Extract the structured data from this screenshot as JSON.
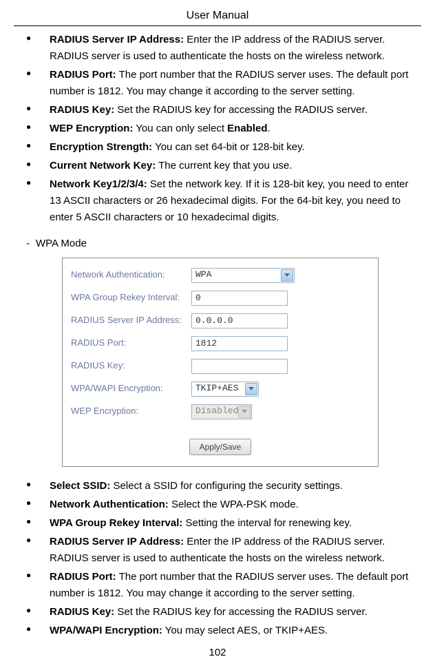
{
  "header": "User Manual",
  "top_bullets": [
    {
      "label": "RADIUS Server IP Address:",
      "text": " Enter the IP address of the RADIUS server. RADIUS server is used to authenticate the hosts on the wireless network."
    },
    {
      "label": "RADIUS Port:",
      "text": " The port number that the RADIUS server uses. The default port number is 1812. You may change it according to the server setting."
    },
    {
      "label": "RADIUS Key:",
      "text": " Set the RADIUS key for accessing the RADIUS server."
    },
    {
      "label": "WEP Encryption:",
      "text": " You can only select ",
      "bold_after": "Enabled",
      "suffix": "."
    },
    {
      "label": "Encryption Strength:",
      "text": " You can set 64-bit or 128-bit key."
    },
    {
      "label": "Current Network Key:",
      "text": " The current key that you use."
    },
    {
      "label": "Network Key1/2/3/4:",
      "text": " Set the network key. If it is 128-bit key, you need to enter 13 ASCII characters or 26 hexadecimal digits. For the 64-bit key, you need to enter 5 ASCII characters or 10 hexadecimal digits."
    }
  ],
  "section_title": "WPA Mode",
  "form": {
    "rows": [
      {
        "label": "Network Authentication:",
        "type": "select_wide",
        "value": "WPA"
      },
      {
        "label": "WPA Group Rekey Interval:",
        "type": "input",
        "value": "0"
      },
      {
        "label": "RADIUS Server IP Address:",
        "type": "input",
        "value": "0.0.0.0"
      },
      {
        "label": "RADIUS Port:",
        "type": "input",
        "value": "1812"
      },
      {
        "label": "RADIUS Key:",
        "type": "input",
        "value": ""
      },
      {
        "label": "WPA/WAPI Encryption:",
        "type": "select_medium",
        "value": "TKIP+AES"
      },
      {
        "label": "WEP Encryption:",
        "type": "select_disabled",
        "value": "Disabled"
      }
    ],
    "button": "Apply/Save"
  },
  "bottom_bullets": [
    {
      "label": "Select SSID:",
      "text": " Select a SSID for configuring the security settings."
    },
    {
      "label": "Network Authentication:",
      "text": " Select the WPA-PSK mode."
    },
    {
      "label": "WPA Group Rekey Interval:",
      "text": " Setting the interval for renewing key."
    },
    {
      "label": "RADIUS Server IP Address:",
      "text": " Enter the IP address of the RADIUS server. RADIUS server is used to authenticate the hosts on the wireless network."
    },
    {
      "label": "RADIUS Port:",
      "text": " The port number that the RADIUS server uses. The default port number is 1812. You may change it according to the server setting."
    },
    {
      "label": "RADIUS Key:",
      "text": " Set the RADIUS key for accessing the RADIUS server."
    },
    {
      "label": "WPA/WAPI Encryption:",
      "text": " You may select AES, or TKIP+AES."
    }
  ],
  "page_number": "102"
}
